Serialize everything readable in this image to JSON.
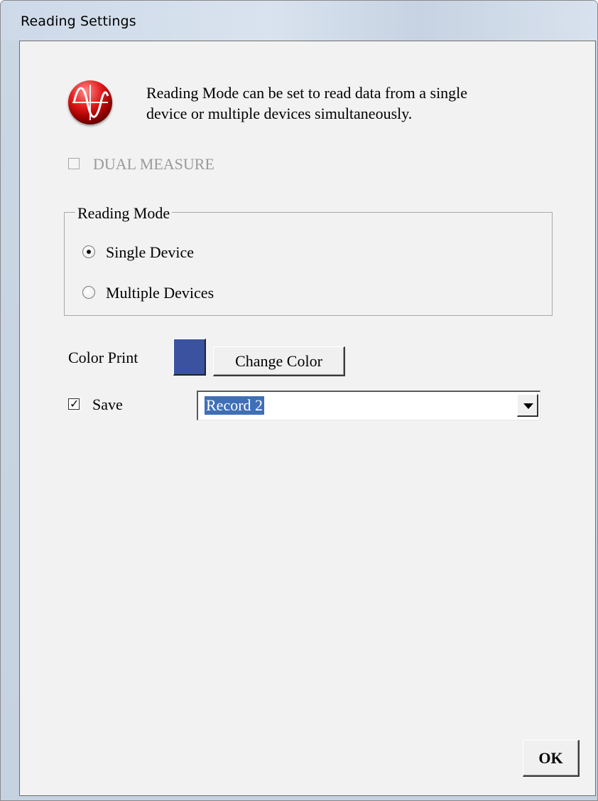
{
  "window": {
    "title": "Reading Settings"
  },
  "info": {
    "icon": "waveform-logo-icon",
    "line1": "Reading Mode can be set to read data from a single",
    "line2": "device or multiple devices simultaneously."
  },
  "dual_measure": {
    "label": "DUAL MEASURE",
    "checked": false,
    "enabled": false
  },
  "reading_mode": {
    "group_label": "Reading Mode",
    "options": [
      {
        "label": "Single Device",
        "selected": true
      },
      {
        "label": "Multiple Devices",
        "selected": false
      }
    ]
  },
  "color_print": {
    "label": "Color Print",
    "swatch_color": "#3a52a0",
    "button_label": "Change Color"
  },
  "save": {
    "label": "Save",
    "checked": true,
    "record_value": "Record 2"
  },
  "ok_button": {
    "label": "OK"
  },
  "colors": {
    "selection": "#3f6fb6",
    "dialog_bg": "#f2f2f2"
  }
}
